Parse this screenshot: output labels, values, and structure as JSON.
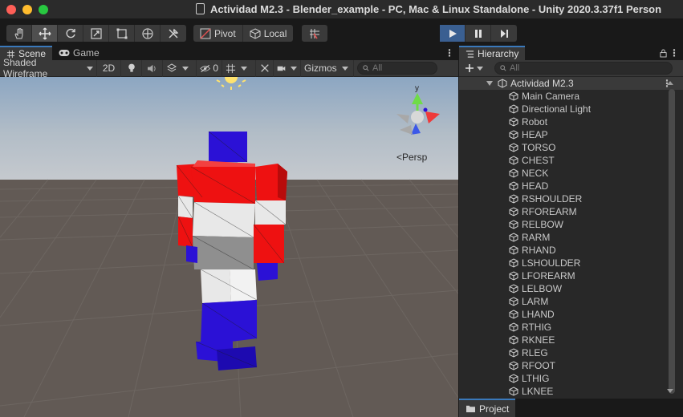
{
  "window": {
    "title": "Actividad M2.3 - Blender_example - PC, Mac & Linux Standalone - Unity 2020.3.37f1 Person",
    "traffic_colors": {
      "close": "#fe5f57",
      "minimize": "#febc2e",
      "zoom": "#28c840"
    }
  },
  "toolbar": {
    "pivot_label": "Pivot",
    "local_label": "Local"
  },
  "scene": {
    "tab_scene": "Scene",
    "tab_game": "Game",
    "draw_mode": "Shaded Wireframe",
    "mode_2d": "2D",
    "hidden_count": "0",
    "gizmos_label": "Gizmos",
    "search_placeholder": "All",
    "persp_label": "<Persp",
    "axis_y_label": "y"
  },
  "hierarchy": {
    "tab_label": "Hierarchy",
    "search_placeholder": "All",
    "root": "Actividad M2.3",
    "items": [
      "Main Camera",
      "Directional Light",
      "Robot",
      "HEAP",
      "TORSO",
      "CHEST",
      "NECK",
      "HEAD",
      "RSHOULDER",
      "RFOREARM",
      "RELBOW",
      "RARM",
      "RHAND",
      "LSHOULDER",
      "LFOREARM",
      "LELBOW",
      "LARM",
      "LHAND",
      "RTHIG",
      "RKNEE",
      "RLEG",
      "RFOOT",
      "LTHIG",
      "LKNEE"
    ]
  },
  "project": {
    "tab_label": "Project"
  },
  "colors": {
    "accent": "#3a79bb",
    "play_active": "#3a5f91",
    "robot_red": "#ee1111",
    "robot_blue": "#2b11d6",
    "robot_white": "#e8e8e8",
    "robot_gray": "#8f8f8f"
  }
}
